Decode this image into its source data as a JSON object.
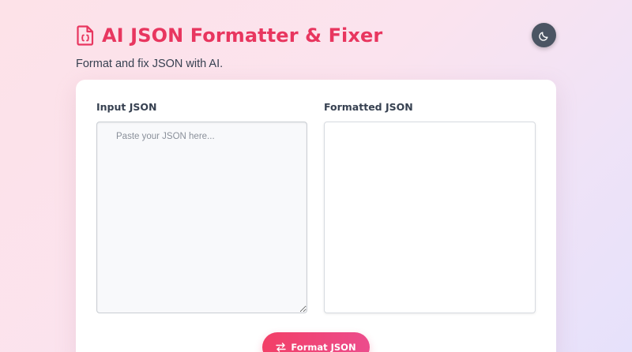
{
  "header": {
    "title": "AI JSON Formatter & Fixer",
    "subtitle": "Format and fix JSON with AI.",
    "logo_icon": "file-code-icon",
    "theme_toggle_icon": "moon-icon"
  },
  "input": {
    "label": "Input JSON",
    "placeholder": "Paste your JSON here...",
    "value": ""
  },
  "output": {
    "label": "Formatted JSON",
    "value": ""
  },
  "actions": {
    "format_label": "Format JSON",
    "format_icon": "swap-arrows-icon"
  },
  "colors": {
    "accent": "#e8365f",
    "button_start": "#f23f67",
    "button_end": "#ec4c8c",
    "toggle_bg": "#4b5563"
  }
}
